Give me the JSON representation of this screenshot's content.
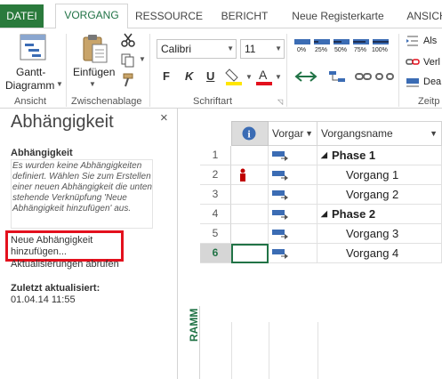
{
  "tabs": {
    "file": "DATEI",
    "active": "VORGANG",
    "items": [
      "RESSOURCE",
      "BERICHT",
      "Neue Registerkarte",
      "ANSICH"
    ]
  },
  "ribbon": {
    "gantt_label_1": "Gantt-",
    "gantt_label_2": "Diagramm",
    "paste_label": "Einfügen",
    "group_view": "Ansicht",
    "group_clipboard": "Zwischenablage",
    "group_font": "Schriftart",
    "group_schedule": "Zeitp",
    "font_name": "Calibri",
    "font_size": "11",
    "bold": "F",
    "italic": "K",
    "underline": "U",
    "pct_labels": [
      "0%",
      "25%",
      "50%",
      "75%",
      "100%"
    ],
    "right_items": [
      "Als",
      "Verl",
      "Dea"
    ]
  },
  "pane": {
    "title": "Abhängigkeit",
    "close": "×",
    "heading": "Abhängigkeit",
    "description": "Es wurden keine Abhängigkeiten definiert. Wählen Sie zum Erstellen einer neuen Abhängigkeit die unten stehende Verknüpfung 'Neue Abhängigkeit hinzufügen' aus.",
    "new_link": "Neue Abhängigkeit hinzufügen...",
    "refresh": "Aktualisierungen abrufen",
    "updated_heading": "Zuletzt aktualisiert:",
    "updated_value": "01.04.14 11:55"
  },
  "grid": {
    "col_mode": "Vorgar",
    "col_name": "Vorgangsname",
    "info_icon": "i",
    "side_label": "RAMM",
    "rows": [
      {
        "num": "1",
        "name": "Phase 1",
        "summary": true,
        "indicator": false
      },
      {
        "num": "2",
        "name": "Vorgang 1",
        "summary": false,
        "indicator": true
      },
      {
        "num": "3",
        "name": "Vorgang 2",
        "summary": false,
        "indicator": false
      },
      {
        "num": "4",
        "name": "Phase 2",
        "summary": true,
        "indicator": false
      },
      {
        "num": "5",
        "name": "Vorgang 3",
        "summary": false,
        "indicator": false
      },
      {
        "num": "6",
        "name": "Vorgang 4",
        "summary": false,
        "indicator": false
      }
    ]
  },
  "colors": {
    "accent": "#217346",
    "file_tab": "#2a7a3c",
    "highlight": "#e3101d",
    "task_icon": "#3b6cb4"
  }
}
